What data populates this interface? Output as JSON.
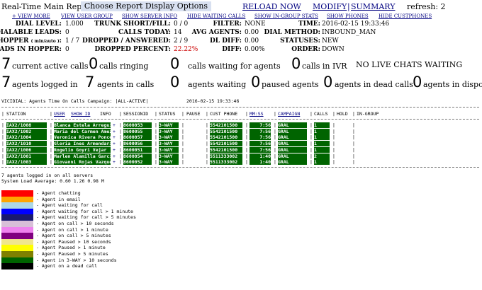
{
  "header": {
    "title": "Real-Time Main Report",
    "report_options": "Choose Report Display Options",
    "reload": "RELOAD NOW",
    "modify": "MODIFY",
    "separator": "|",
    "summary": "SUMMARY",
    "refresh": "refresh: 2"
  },
  "toolbar": {
    "view_more": "+ VIEW MORE",
    "view_user_group": "VIEW USER GROUP",
    "show_server_info": "SHOW SERVER INFO",
    "hide_waiting_calls": "HIDE WAITING CALLS",
    "show_ingroup_stats": "SHOW IN-GROUP STATS",
    "show_phones": "SHOW PHONES",
    "hide_custphones": "HIDE CUSTPHONES"
  },
  "stats": {
    "dial_level_label": "DIAL LEVEL:",
    "dial_level": "1.000",
    "trunk_label": "TRUNK SHORT/FILL:",
    "trunk": "0 / 0",
    "filter_label": "FILTER:",
    "filter": "NONE",
    "time_label": "TIME:",
    "time": "2016-02-15 19:33:46",
    "dialable_label": "DIALABLE LEADS:",
    "dialable": "0",
    "calls_today_label": "CALLS TODAY:",
    "calls_today": "14",
    "avg_agents_label": "AVG AGENTS:",
    "avg_agents": "0.00",
    "dial_method_label": "DIAL METHOD:",
    "dial_method": "INBOUND_MAN",
    "hopper_label": "HOPPER",
    "hopper_sub": "( min/auto )",
    "hopper_colon": ":",
    "hopper": "1 / 7",
    "dropped_answered_label": "DROPPED / ANSWERED:",
    "dropped_answered": "2 / 9",
    "dl_diff_label": "DL DIFF:",
    "dl_diff": "0.00",
    "statuses_label": "STATUSES:",
    "statuses": "NEW",
    "leads_hopper_label": "LEADS IN HOPPER:",
    "leads_hopper": "0",
    "dropped_percent_label": "DROPPED PERCENT:",
    "dropped_percent": "22.22%",
    "diff_label": "DIFF:",
    "diff": "0.00%",
    "order_label": "ORDER:",
    "order": "DOWN"
  },
  "counters": {
    "active_calls": "7",
    "active_calls_label": "current active calls",
    "ringing": "0",
    "ringing_label": "calls ringing",
    "waiting": "0",
    "waiting_label": "calls waiting for agents",
    "ivr": "0",
    "ivr_label": "calls in IVR",
    "chats": "NO LIVE CHATS WAITING",
    "logged_in": "7",
    "logged_in_label": "agents logged in",
    "in_calls": "7",
    "in_calls_label": "agents in calls",
    "agents_waiting": "0",
    "agents_waiting_label": "agents waiting",
    "paused": "0",
    "paused_label": "paused agents",
    "dead": "0",
    "dead_label": "agents in dead calls",
    "dispo": "0",
    "dispo_label": "agents in dispo"
  },
  "agent_table": {
    "caption": "VICIDIAL: Agents Time On Calls Campaign: |ALL-ACTIVE|",
    "timestamp": "2016-02-15 19:33:46",
    "headers": {
      "station": "STATION",
      "user": "USER",
      "show_id": "SHOW ID",
      "info": "INFO",
      "sessionid": "SESSIONID",
      "status": "STATUS",
      "pause": "PAUSE",
      "cust_phone": "CUST PHONE",
      "mmss": "MM:SS",
      "campaign": "CAMPAIGN",
      "calls": "CALLS",
      "hold": "HOLD",
      "ingroup": "IN-GROUP"
    },
    "rows": [
      {
        "station": "IAX2/1008",
        "user": "Blanca Estela Arreguin",
        "session": "8600053",
        "status": "3-WAY",
        "phone": "5542101500",
        "mmss": "7:56",
        "campaign": "GRAL",
        "calls": "1"
      },
      {
        "station": "IAX2/1002",
        "user": "Maria del Carmen Amezcua",
        "session": "8600055",
        "status": "3-WAY",
        "phone": "5542101500",
        "mmss": "7:56",
        "campaign": "GRAL",
        "calls": "1"
      },
      {
        "station": "IAX2/1004",
        "user": "Veronica Rivera Ponce",
        "session": "8600057",
        "status": "3-WAY",
        "phone": "5542101500",
        "mmss": "7:56",
        "campaign": "GRAL",
        "calls": "1"
      },
      {
        "station": "IAX2/1010",
        "user": "Gloria Ines Armendariz",
        "session": "8600056",
        "status": "3-WAY",
        "phone": "5542101500",
        "mmss": "7:56",
        "campaign": "GRAL",
        "calls": "1"
      },
      {
        "station": "IAX2/1006",
        "user": "Rogelio Goyri Vejar",
        "session": "8600051",
        "status": "3-WAY",
        "phone": "5542101500",
        "mmss": "7:56",
        "campaign": "GRAL",
        "calls": "1"
      },
      {
        "station": "IAX2/1001",
        "user": "Marlen Alamilla Garcia",
        "session": "8600054",
        "status": "3-WAY",
        "phone": "5511333002",
        "mmss": "1:40",
        "campaign": "GRAL",
        "calls": "2"
      },
      {
        "station": "IAX2/1003",
        "user": "Giovanni Rojas Vazquez",
        "session": "8600052",
        "status": "3-WAY",
        "phone": "5511333002",
        "mmss": "1:40",
        "campaign": "GRAL",
        "calls": "1"
      }
    ],
    "plus": "+",
    "footer_logged": "7 agents logged in on all servers",
    "footer_load": "System Load Average: 0.60 1.26 0.98    M"
  },
  "legend": [
    {
      "color": "#ff0000",
      "label": "- Agent chatting"
    },
    {
      "color": "#ffa500",
      "label": "- Agent in email"
    },
    {
      "color": "#add8e6",
      "label": "- Agent waiting for call"
    },
    {
      "color": "#0000ff",
      "label": "- Agent waiting for call > 1 minute"
    },
    {
      "color": "#191970",
      "label": "- Agent waiting for call > 5 minutes"
    },
    {
      "color": "#d8bfd8",
      "label": "- Agent on call > 10 seconds"
    },
    {
      "color": "#ee82ee",
      "label": "- Agent on call > 1 minute"
    },
    {
      "color": "#800080",
      "label": "- Agent on call > 5 minutes"
    },
    {
      "color": "#f0e68c",
      "label": "- Agent Paused > 10 seconds"
    },
    {
      "color": "#ffff00",
      "label": "- Agent Paused > 1 minute"
    },
    {
      "color": "#808000",
      "label": "- Agent Paused > 5 minutes"
    },
    {
      "color": "#006400",
      "label": "- Agent in 3-WAY > 10 seconds"
    },
    {
      "color": "#000000",
      "label": "- Agent on a dead call"
    }
  ]
}
